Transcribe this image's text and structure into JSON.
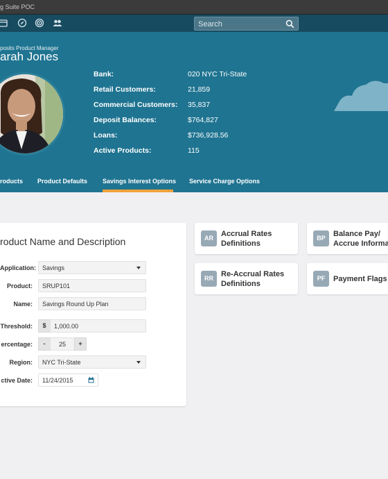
{
  "window": {
    "title": "g Suite POC"
  },
  "navbar": {
    "icons": [
      "card-icon",
      "compass-icon",
      "target-icon",
      "users-icon"
    ],
    "search": {
      "placeholder": "Search"
    }
  },
  "profile": {
    "role": "posits Product Manager",
    "name": "arah Jones",
    "stats": [
      {
        "label": "Bank:",
        "value": "020 NYC Tri-State"
      },
      {
        "label": "Retail Customers:",
        "value": "21,859"
      },
      {
        "label": "Commercial Customers:",
        "value": "35,837"
      },
      {
        "label": "Deposit Balances:",
        "value": "$764,827"
      },
      {
        "label": "Loans:",
        "value": "$736,928.56"
      },
      {
        "label": "Active Products:",
        "value": "115"
      }
    ]
  },
  "tabs": [
    {
      "label": "roducts",
      "active": false
    },
    {
      "label": "Product Defaults",
      "active": false
    },
    {
      "label": "Savings Interest Options",
      "active": true
    },
    {
      "label": "Service Charge Options",
      "active": false
    }
  ],
  "accent_color": "#f0a23b",
  "form": {
    "title": "roduct Name and Description",
    "application": {
      "label": "Application:",
      "value": "Savings"
    },
    "product": {
      "label": "Product:",
      "value": "SRUP101"
    },
    "name": {
      "label": "Name:",
      "value": "Savings Round Up Plan"
    },
    "threshold": {
      "label": "Threshold:",
      "prefix": "$",
      "value": "1,000.00"
    },
    "percentage": {
      "label": "ercentage:",
      "minus": "-",
      "value": "25",
      "plus": "+"
    },
    "region": {
      "label": "Region:",
      "value": "NYC Tri-State"
    },
    "effective_date": {
      "label": "ctive Date:",
      "value": "11/24/2015"
    }
  },
  "tiles": [
    {
      "badge": "AR",
      "line1": "Accrual Rates",
      "line2": "Definitions"
    },
    {
      "badge": "BP",
      "line1": "Balance Pay/",
      "line2": "Accrue Informat"
    },
    {
      "badge": "RR",
      "line1": "Re-Accrual Rates",
      "line2": "Definitions"
    },
    {
      "badge": "PF",
      "line1": "Payment Flags",
      "line2": ""
    }
  ]
}
